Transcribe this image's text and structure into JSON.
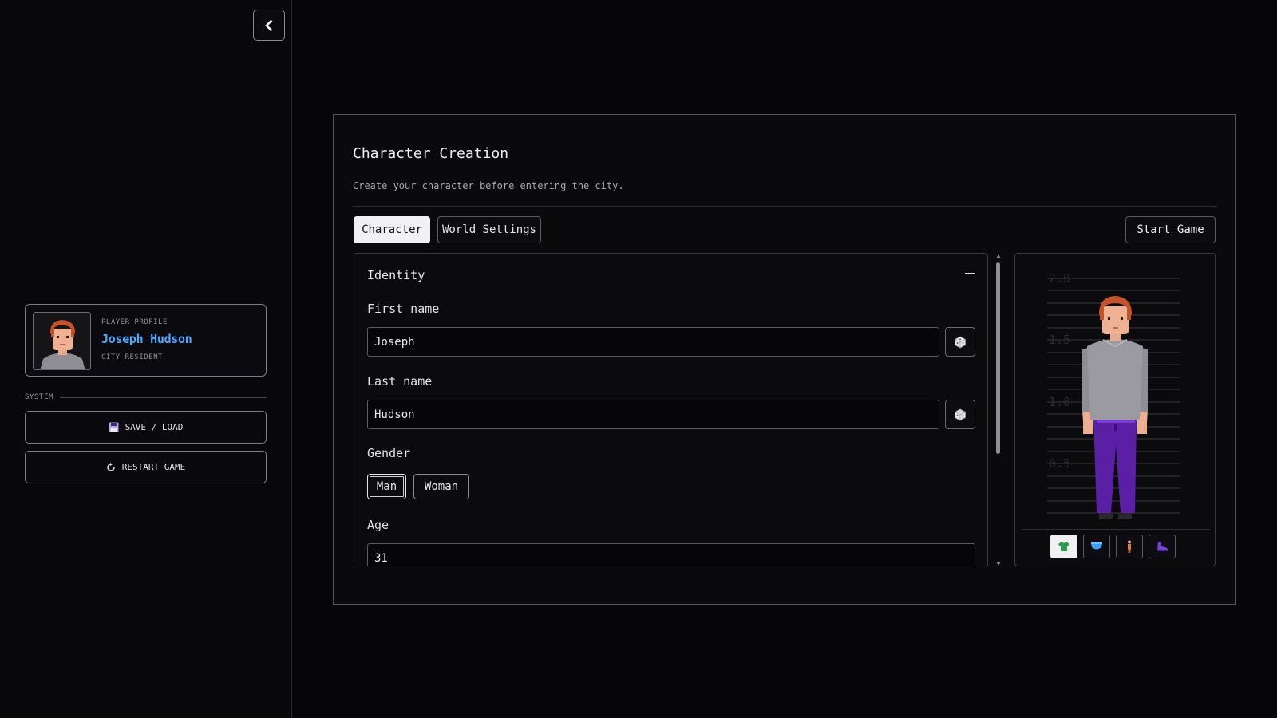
{
  "sidebar": {
    "collapse_icon": "chevron-left-icon",
    "profile": {
      "label": "PLAYER PROFILE",
      "name": "Joseph Hudson",
      "subtitle": "CITY RESIDENT"
    },
    "system_label": "SYSTEM",
    "buttons": {
      "save_load": "SAVE / LOAD",
      "restart": "RESTART GAME"
    }
  },
  "panel": {
    "title": "Character Creation",
    "description": "Create your character before entering the city.",
    "tabs": [
      {
        "label": "Character",
        "active": true
      },
      {
        "label": "World Settings",
        "active": false
      }
    ],
    "start_button": "Start Game",
    "identity": {
      "section_title": "Identity",
      "first_name": {
        "label": "First name",
        "value": "Joseph"
      },
      "last_name": {
        "label": "Last name",
        "value": "Hudson"
      },
      "gender": {
        "label": "Gender",
        "options": [
          "Man",
          "Woman"
        ],
        "selected": "Man"
      },
      "age": {
        "label": "Age",
        "value": "31"
      }
    },
    "preview": {
      "height_ticks": [
        "2.0",
        "1.5",
        "1.0",
        "0.5"
      ],
      "outfit_buttons": [
        "shirt-icon",
        "pants-icon",
        "body-icon",
        "shoe-icon"
      ],
      "selected_outfit": "shirt-icon"
    }
  },
  "colors": {
    "accent_name": "#4aa8ff",
    "hair": "#c4532a",
    "shirt": "#9a9aa0",
    "pants": "#5b1fa6"
  }
}
